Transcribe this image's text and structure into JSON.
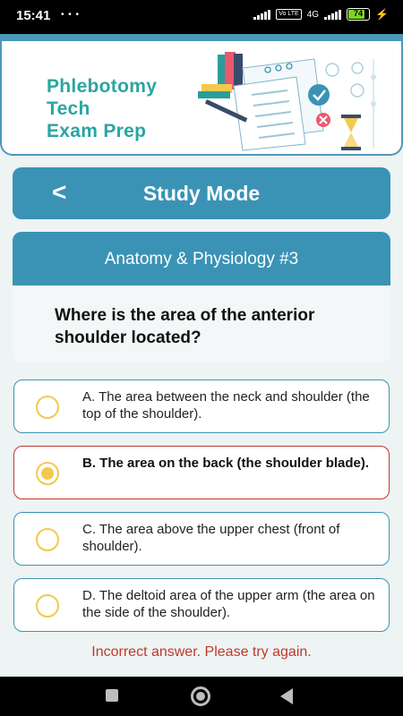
{
  "status_bar": {
    "time": "15:41",
    "network": "4G",
    "volte": "Vo LTE",
    "battery": "74"
  },
  "banner": {
    "title_line1": "Phlebotomy",
    "title_line2": "Tech",
    "title_line3": "Exam Prep"
  },
  "mode_bar": {
    "back_glyph": "<",
    "title": "Study Mode"
  },
  "question": {
    "category": "Anatomy & Physiology #3",
    "text": "Where is the area of the anterior shoulder located?"
  },
  "options": [
    {
      "text": "A. The area between the neck and shoulder (the top of the shoulder).",
      "selected": false
    },
    {
      "text": "B. The area on the back (the shoulder blade).",
      "selected": true
    },
    {
      "text": "C. The area above the upper chest (front of shoulder).",
      "selected": false
    },
    {
      "text": "D. The deltoid area of the upper arm (the area on the side of the shoulder).",
      "selected": false
    }
  ],
  "feedback": "Incorrect answer. Please try again.",
  "colors": {
    "primary": "#3a93b5",
    "title_teal": "#2aa5a1",
    "error": "#c0392b",
    "radio": "#f2c94c"
  }
}
